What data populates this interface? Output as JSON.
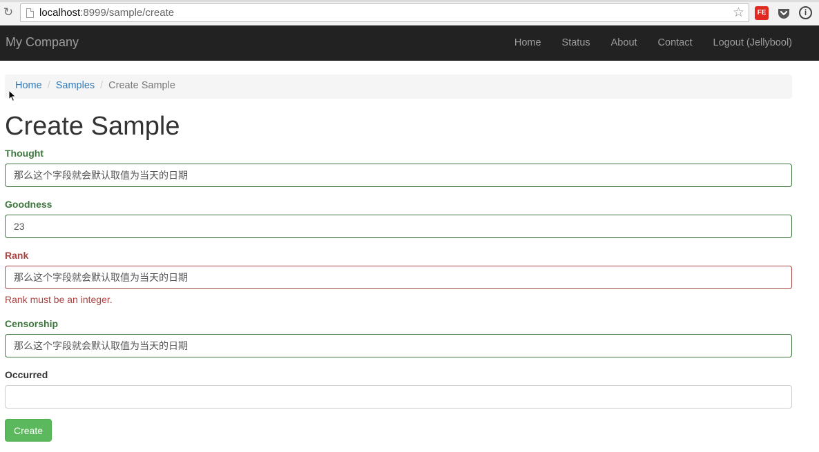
{
  "browser": {
    "url_host": "localhost",
    "url_path": ":8999/sample/create",
    "ext_fe_label": "FE",
    "ext_info_label": "i"
  },
  "navbar": {
    "brand": "My Company",
    "items": [
      {
        "label": "Home"
      },
      {
        "label": "Status"
      },
      {
        "label": "About"
      },
      {
        "label": "Contact"
      },
      {
        "label": "Logout (Jellybool)"
      }
    ]
  },
  "breadcrumb": {
    "items": [
      "Home",
      "Samples"
    ],
    "separator": "/",
    "active": "Create Sample"
  },
  "page": {
    "title": "Create Sample"
  },
  "form": {
    "fields": [
      {
        "label": "Thought",
        "value": "那么这个字段就会默认取值为当天的日期",
        "state": "success"
      },
      {
        "label": "Goodness",
        "value": "23",
        "state": "success"
      },
      {
        "label": "Rank",
        "value": "那么这个字段就会默认取值为当天的日期",
        "state": "error",
        "error": "Rank must be an integer."
      },
      {
        "label": "Censorship",
        "value": "那么这个字段就会默认取值为当天的日期",
        "state": "success"
      },
      {
        "label": "Occurred",
        "value": "",
        "state": "default"
      }
    ],
    "submit_label": "Create"
  },
  "colors": {
    "navbar_bg": "#222222",
    "success": "#3c763d",
    "error": "#a94442",
    "link": "#337ab7",
    "button": "#5cb85c"
  }
}
